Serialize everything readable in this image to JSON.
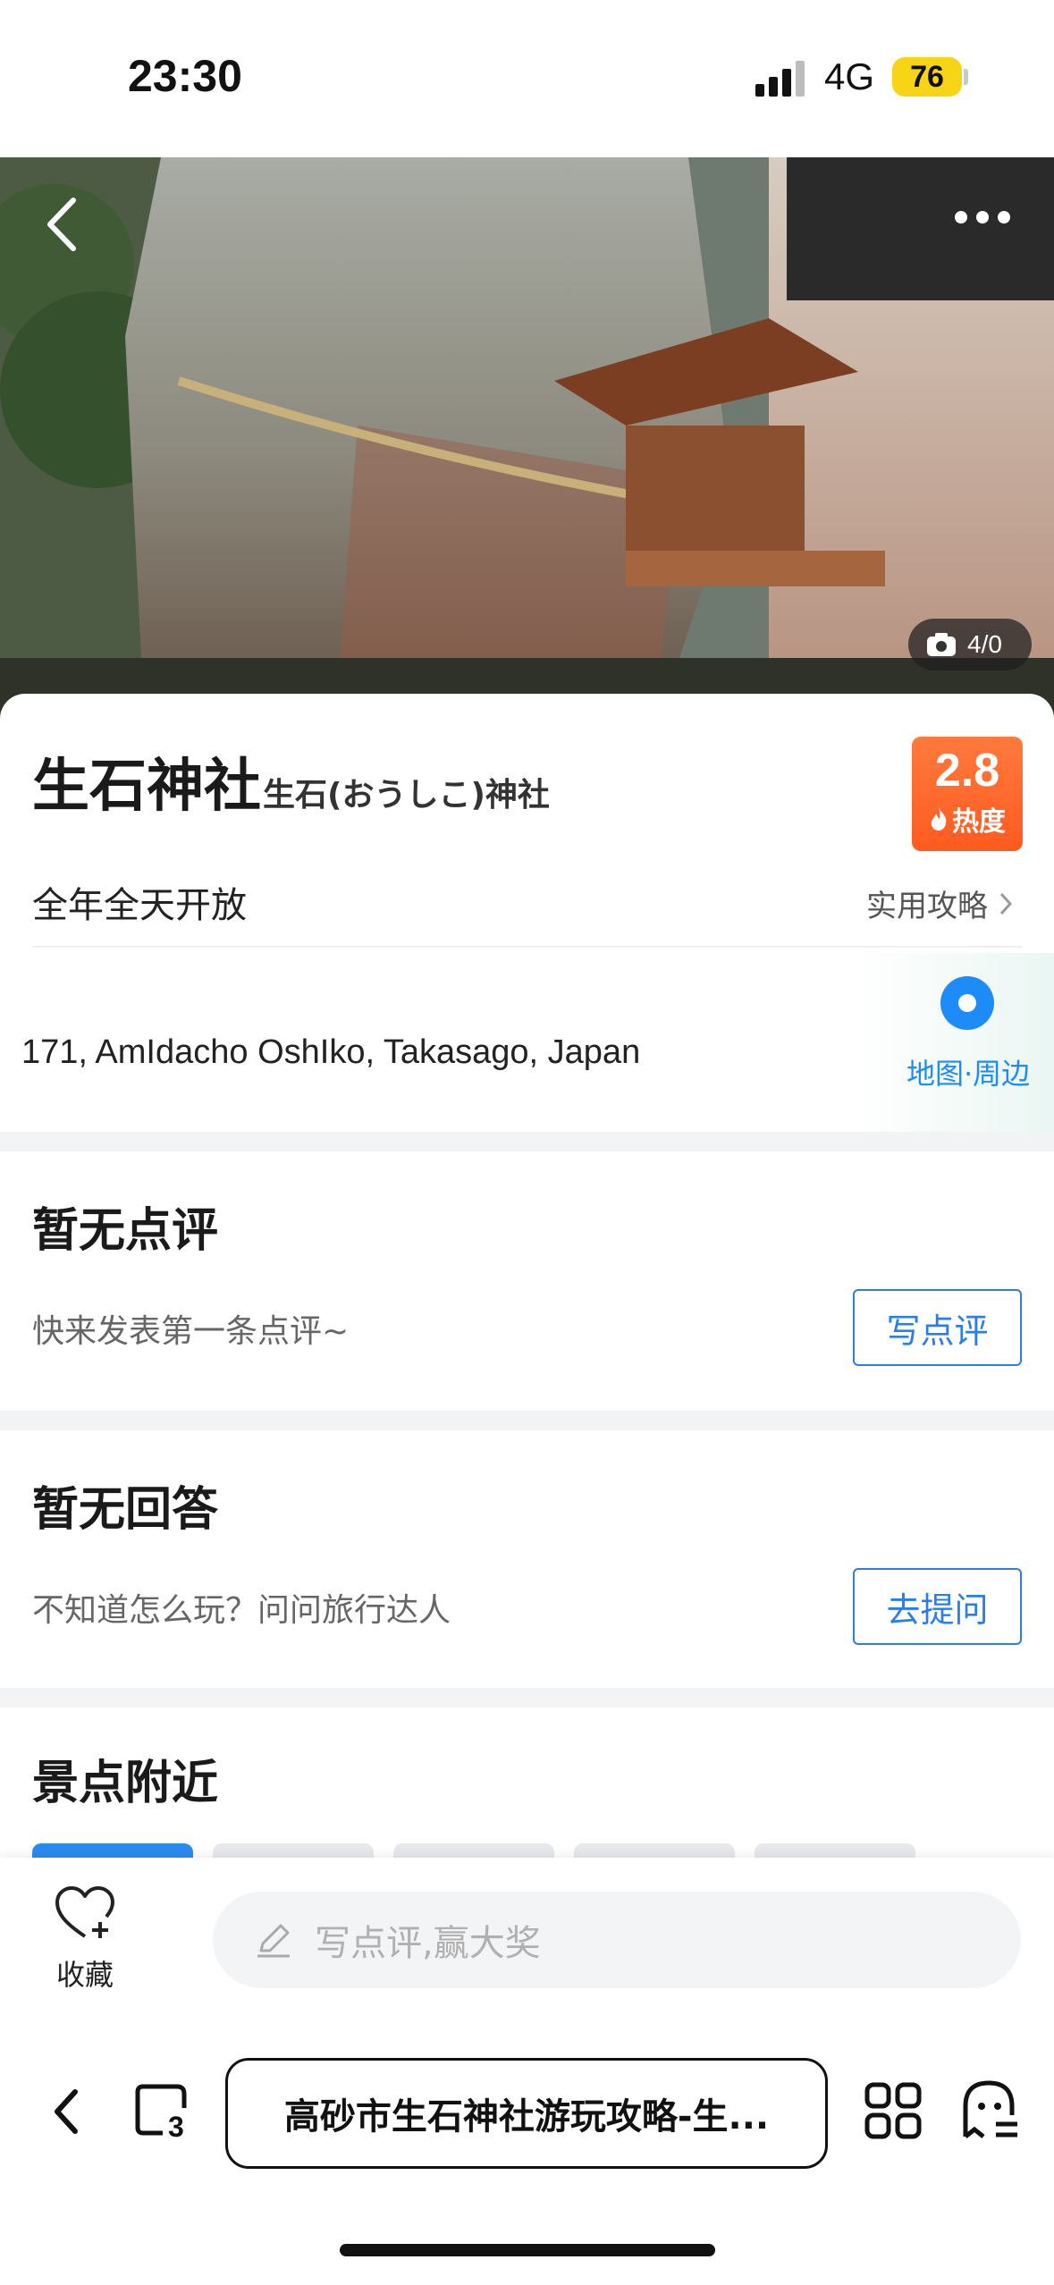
{
  "status_bar": {
    "time": "23:30",
    "network": "4G",
    "battery": "76"
  },
  "hero": {
    "photo_counter": "4/0",
    "colors": {
      "overlay": "#1e1e1e"
    }
  },
  "place": {
    "title": "生石神社",
    "subtitle": "生石(おうしこ)神社",
    "heat_value": "2.8",
    "heat_label": "热度",
    "hours": "全年全天开放",
    "guide_link": "实用攻略",
    "address": "171, AmIdacho OshIko, Takasago, Japan",
    "map_label": "地图·周边"
  },
  "reviews": {
    "title": "暂无点评",
    "desc": "快来发表第一条点评~",
    "button": "写点评"
  },
  "answers": {
    "title": "暂无回答",
    "desc": "不知道怎么玩？问问旅行达人",
    "button": "去提问"
  },
  "nearby": {
    "title": "景点附近"
  },
  "action_bar": {
    "favorite_label": "收藏",
    "review_placeholder": "写点评,赢大奖"
  },
  "browser": {
    "tab_count": "3",
    "url_title": "高砂市生石神社游玩攻略-生..."
  },
  "colors": {
    "accent_blue": "#2a7ee6",
    "heat_orange": "#ff5a1f",
    "battery_yellow": "#f7d415",
    "divider_gray": "#f1f3f5"
  }
}
